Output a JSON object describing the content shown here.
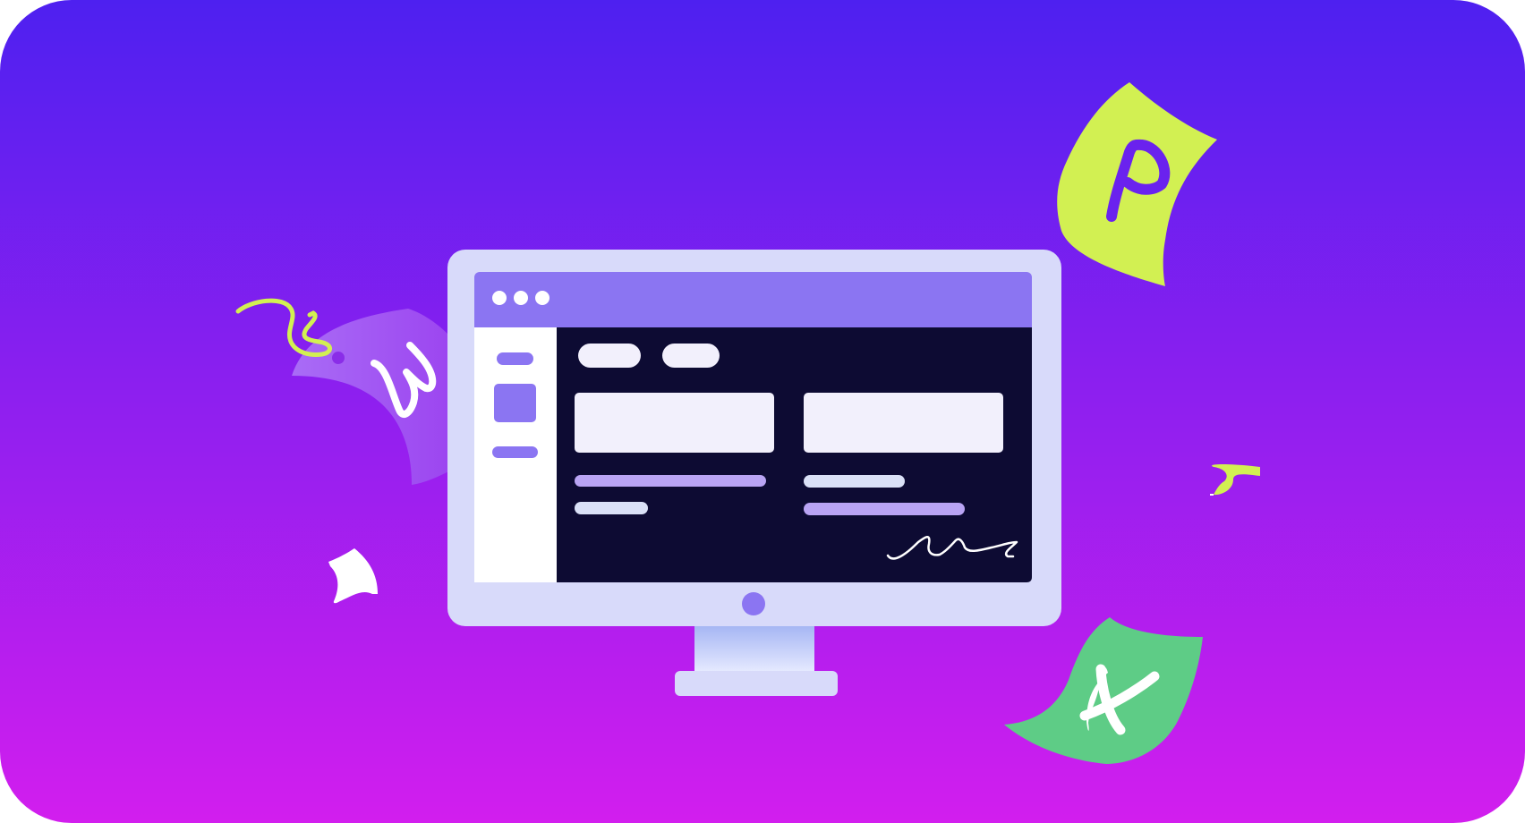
{
  "illustration": {
    "colors": {
      "bg_top": "#4E20F0",
      "bg_bottom": "#D21EEE",
      "monitor_frame": "#D8DAFA",
      "window_bar": "#8B75F2",
      "screen_dark": "#0D0B33",
      "card": "#F2F0FC",
      "accent_purple": "#B9A4F4",
      "accent_light": "#DAE1F7",
      "lime": "#D2F052",
      "green": "#5ECC86",
      "white": "#FFFFFF"
    },
    "icons": [
      "word-document-icon",
      "powerpoint-document-icon",
      "excel-document-icon",
      "signature-icon"
    ],
    "window_dots": 3,
    "tabs": 2,
    "cards": 2,
    "lines": 4
  }
}
